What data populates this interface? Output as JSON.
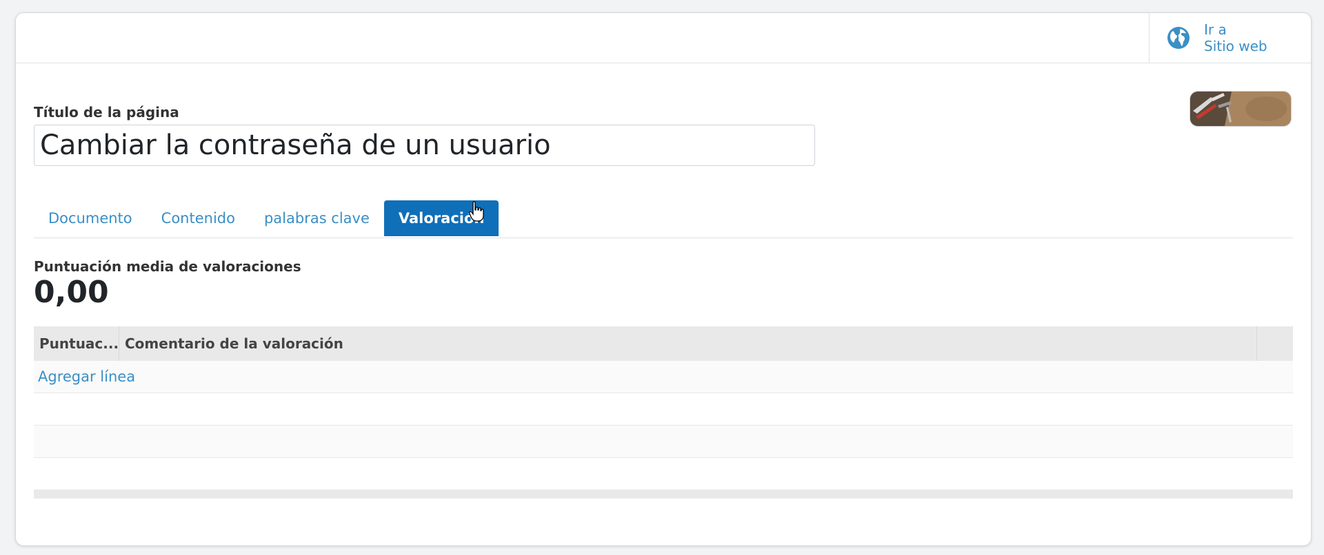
{
  "smart_button": {
    "line1": "Ir a",
    "line2": "Sitio web",
    "icon": "globe-icon"
  },
  "form": {
    "title_label": "Título de la página",
    "title_value": "Cambiar la contraseña de un usuario"
  },
  "tabs": [
    {
      "label": "Documento",
      "active": false
    },
    {
      "label": "Contenido",
      "active": false
    },
    {
      "label": "palabras clave",
      "active": false
    },
    {
      "label": "Valoración",
      "active": true
    }
  ],
  "rating": {
    "avg_label": "Puntuación media de valoraciones",
    "avg_value": "0,00"
  },
  "table": {
    "columns": [
      "Puntuac...",
      "Comentario de la valoración"
    ],
    "add_line": "Agregar línea"
  },
  "colors": {
    "accent": "#0f6fb8",
    "link": "#3a8fc6"
  }
}
